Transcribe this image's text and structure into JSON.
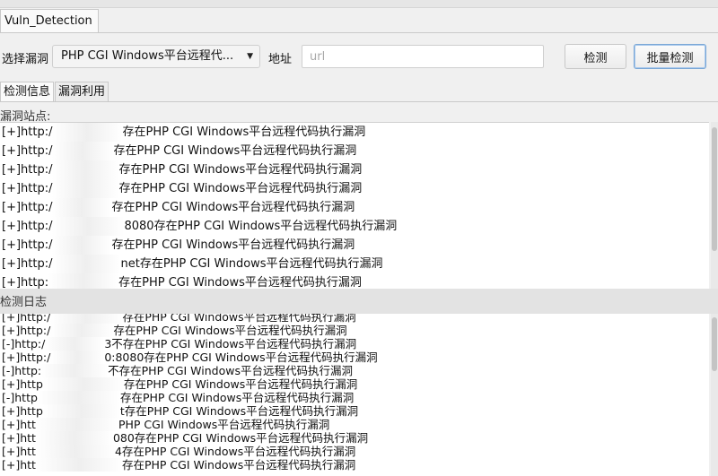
{
  "window": {
    "tab_title": "Vuln_Detection"
  },
  "controls": {
    "select_vuln_label": "选择漏洞",
    "selected_vuln": "PHP CGI Windows平台远程代...",
    "address_label": "地址",
    "url_placeholder": "url",
    "detect_button": "检测",
    "batch_detect_button": "批量检测"
  },
  "tabs": [
    {
      "label": "检测信息",
      "active": true
    },
    {
      "label": "漏洞利用",
      "active": false
    }
  ],
  "vuln_section": {
    "title": "漏洞站点:",
    "lines": [
      {
        "prefix": "[+]http:/",
        "suffix": "存在PHP CGI Windows平台远程代码执行漏洞"
      },
      {
        "prefix": "[+]http:/",
        "suffix": "存在PHP CGI Windows平台远程代码执行漏洞"
      },
      {
        "prefix": "[+]http:/",
        "suffix": "存在PHP CGI Windows平台远程代码执行漏洞"
      },
      {
        "prefix": "[+]http:/",
        "suffix": "存在PHP CGI Windows平台远程代码执行漏洞"
      },
      {
        "prefix": "[+]http:/",
        "suffix": "存在PHP CGI Windows平台远程代码执行漏洞"
      },
      {
        "prefix": "[+]http:/",
        "suffix": "8080存在PHP CGI Windows平台远程代码执行漏洞"
      },
      {
        "prefix": "[+]http:/",
        "suffix": "存在PHP CGI Windows平台远程代码执行漏洞"
      },
      {
        "prefix": "[+]http:/",
        "suffix": "net存在PHP CGI Windows平台远程代码执行漏洞"
      },
      {
        "prefix": "[+]http:",
        "suffix": "存在PHP CGI Windows平台远程代码执行漏洞"
      }
    ]
  },
  "log_section": {
    "title": "检测日志",
    "lines": [
      {
        "prefix": "[+]http:/",
        "suffix": "存在PHP CGI Windows平台远程代码执行漏洞"
      },
      {
        "prefix": "[+]http:/",
        "suffix": "存在PHP CGI Windows平台远程代码执行漏洞"
      },
      {
        "prefix": "[-]http:/",
        "suffix": "3不存在PHP CGI Windows平台远程代码执行漏洞"
      },
      {
        "prefix": "[+]http:/",
        "suffix": "0:8080存在PHP CGI Windows平台远程代码执行漏洞"
      },
      {
        "prefix": "[-]http:",
        "suffix": "不存在PHP CGI Windows平台远程代码执行漏洞"
      },
      {
        "prefix": "[+]http",
        "suffix": "存在PHP CGI Windows平台远程代码执行漏洞"
      },
      {
        "prefix": "[-]http",
        "suffix": "存在PHP CGI Windows平台远程代码执行漏洞"
      },
      {
        "prefix": "[+]http",
        "suffix": "t存在PHP CGI Windows平台远程代码执行漏洞"
      },
      {
        "prefix": "[+]htt",
        "suffix": "PHP CGI Windows平台远程代码执行漏洞"
      },
      {
        "prefix": "[+]htt",
        "suffix": "080存在PHP CGI Windows平台远程代码执行漏洞"
      },
      {
        "prefix": "[+]htt",
        "suffix": "4存在PHP CGI Windows平台远程代码执行漏洞"
      },
      {
        "prefix": "[+]htt",
        "suffix": "存在PHP CGI Windows平台远程代码执行漏洞"
      }
    ]
  }
}
